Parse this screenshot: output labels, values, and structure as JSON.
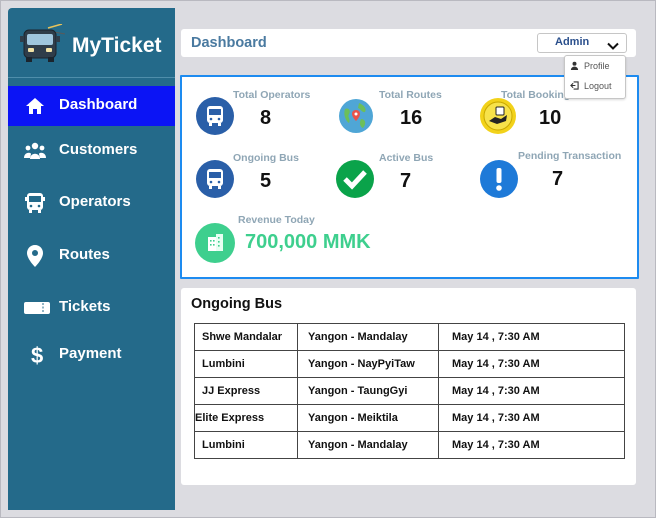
{
  "app": {
    "name": "MyTicket"
  },
  "sidebar": {
    "items": [
      {
        "label": "Dashboard",
        "icon": "home-icon",
        "active": true
      },
      {
        "label": "Customers",
        "icon": "users-icon"
      },
      {
        "label": "Operators",
        "icon": "bus-icon"
      },
      {
        "label": "Routes",
        "icon": "location-pin-icon"
      },
      {
        "label": "Tickets",
        "icon": "ticket-icon"
      },
      {
        "label": "Payment",
        "icon": "dollar-icon"
      }
    ]
  },
  "header": {
    "title": "Dashboard",
    "user_button": "Admin",
    "menu": {
      "profile": "Profile",
      "logout": "Logout"
    }
  },
  "stats": {
    "total_operators": {
      "label": "Total Operators",
      "value": "8"
    },
    "total_routes": {
      "label": "Total Routes",
      "value": "16"
    },
    "total_booking": {
      "label": "Total Booking",
      "value": "10"
    },
    "ongoing_bus": {
      "label": "Ongoing Bus",
      "value": "5"
    },
    "active_bus": {
      "label": "Active Bus",
      "value": "7"
    },
    "pending_transaction": {
      "label": "Pending Transaction",
      "value": "7"
    },
    "revenue_today": {
      "label": "Revenue Today",
      "value": "700,000 MMK"
    }
  },
  "ongoing": {
    "title": "Ongoing Bus",
    "rows": [
      {
        "operator": "Shwe Mandalar",
        "route": "Yangon - Mandalay",
        "time": "May 14 , 7:30 AM"
      },
      {
        "operator": "Lumbini",
        "route": "Yangon - NayPyiTaw",
        "time": "May 14 , 7:30 AM"
      },
      {
        "operator": "JJ Express",
        "route": "Yangon - TaungGyi",
        "time": "May 14 , 7:30 AM"
      },
      {
        "operator": "Elite Express",
        "route": "Yangon - Meiktila",
        "time": "May 14 , 7:30 AM"
      },
      {
        "operator": "Lumbini",
        "route": "Yangon - Mandalay",
        "time": "May 14 , 7:30 AM"
      }
    ]
  },
  "colors": {
    "sidebar": "#246a8a",
    "active_nav": "#0b14f5",
    "stats_border": "#1d8bf0",
    "icon_blue": "#2a5fa8",
    "success_green": "#0aa34a",
    "revenue_green": "#3ecf8e"
  }
}
